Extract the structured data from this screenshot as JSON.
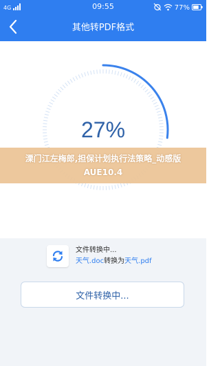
{
  "status_bar": {
    "network": "4G",
    "time": "09:55",
    "battery": "77%",
    "icons": [
      "signal-icon",
      "alarm-off-icon",
      "wifi-icon",
      "battery-icon"
    ]
  },
  "header": {
    "title": "其他转PDF格式",
    "back_icon": "chevron-left-icon"
  },
  "progress": {
    "value_text": "27%",
    "percent": 27
  },
  "banner": {
    "text": "溧门江左梅郎,担保计划执行法策略_动感版AUE10.4"
  },
  "file": {
    "status": "文件转换中...",
    "source_name": "天气.doc",
    "convert_word": "转换为",
    "target_name": "天气.pdf",
    "icon": "sync-icon"
  },
  "button": {
    "label": "文件转换中..."
  },
  "colors": {
    "primary": "#2f7ef0",
    "progress_text": "#2f62a8",
    "banner": "#ecc496",
    "panel": "#f1f4f8"
  }
}
